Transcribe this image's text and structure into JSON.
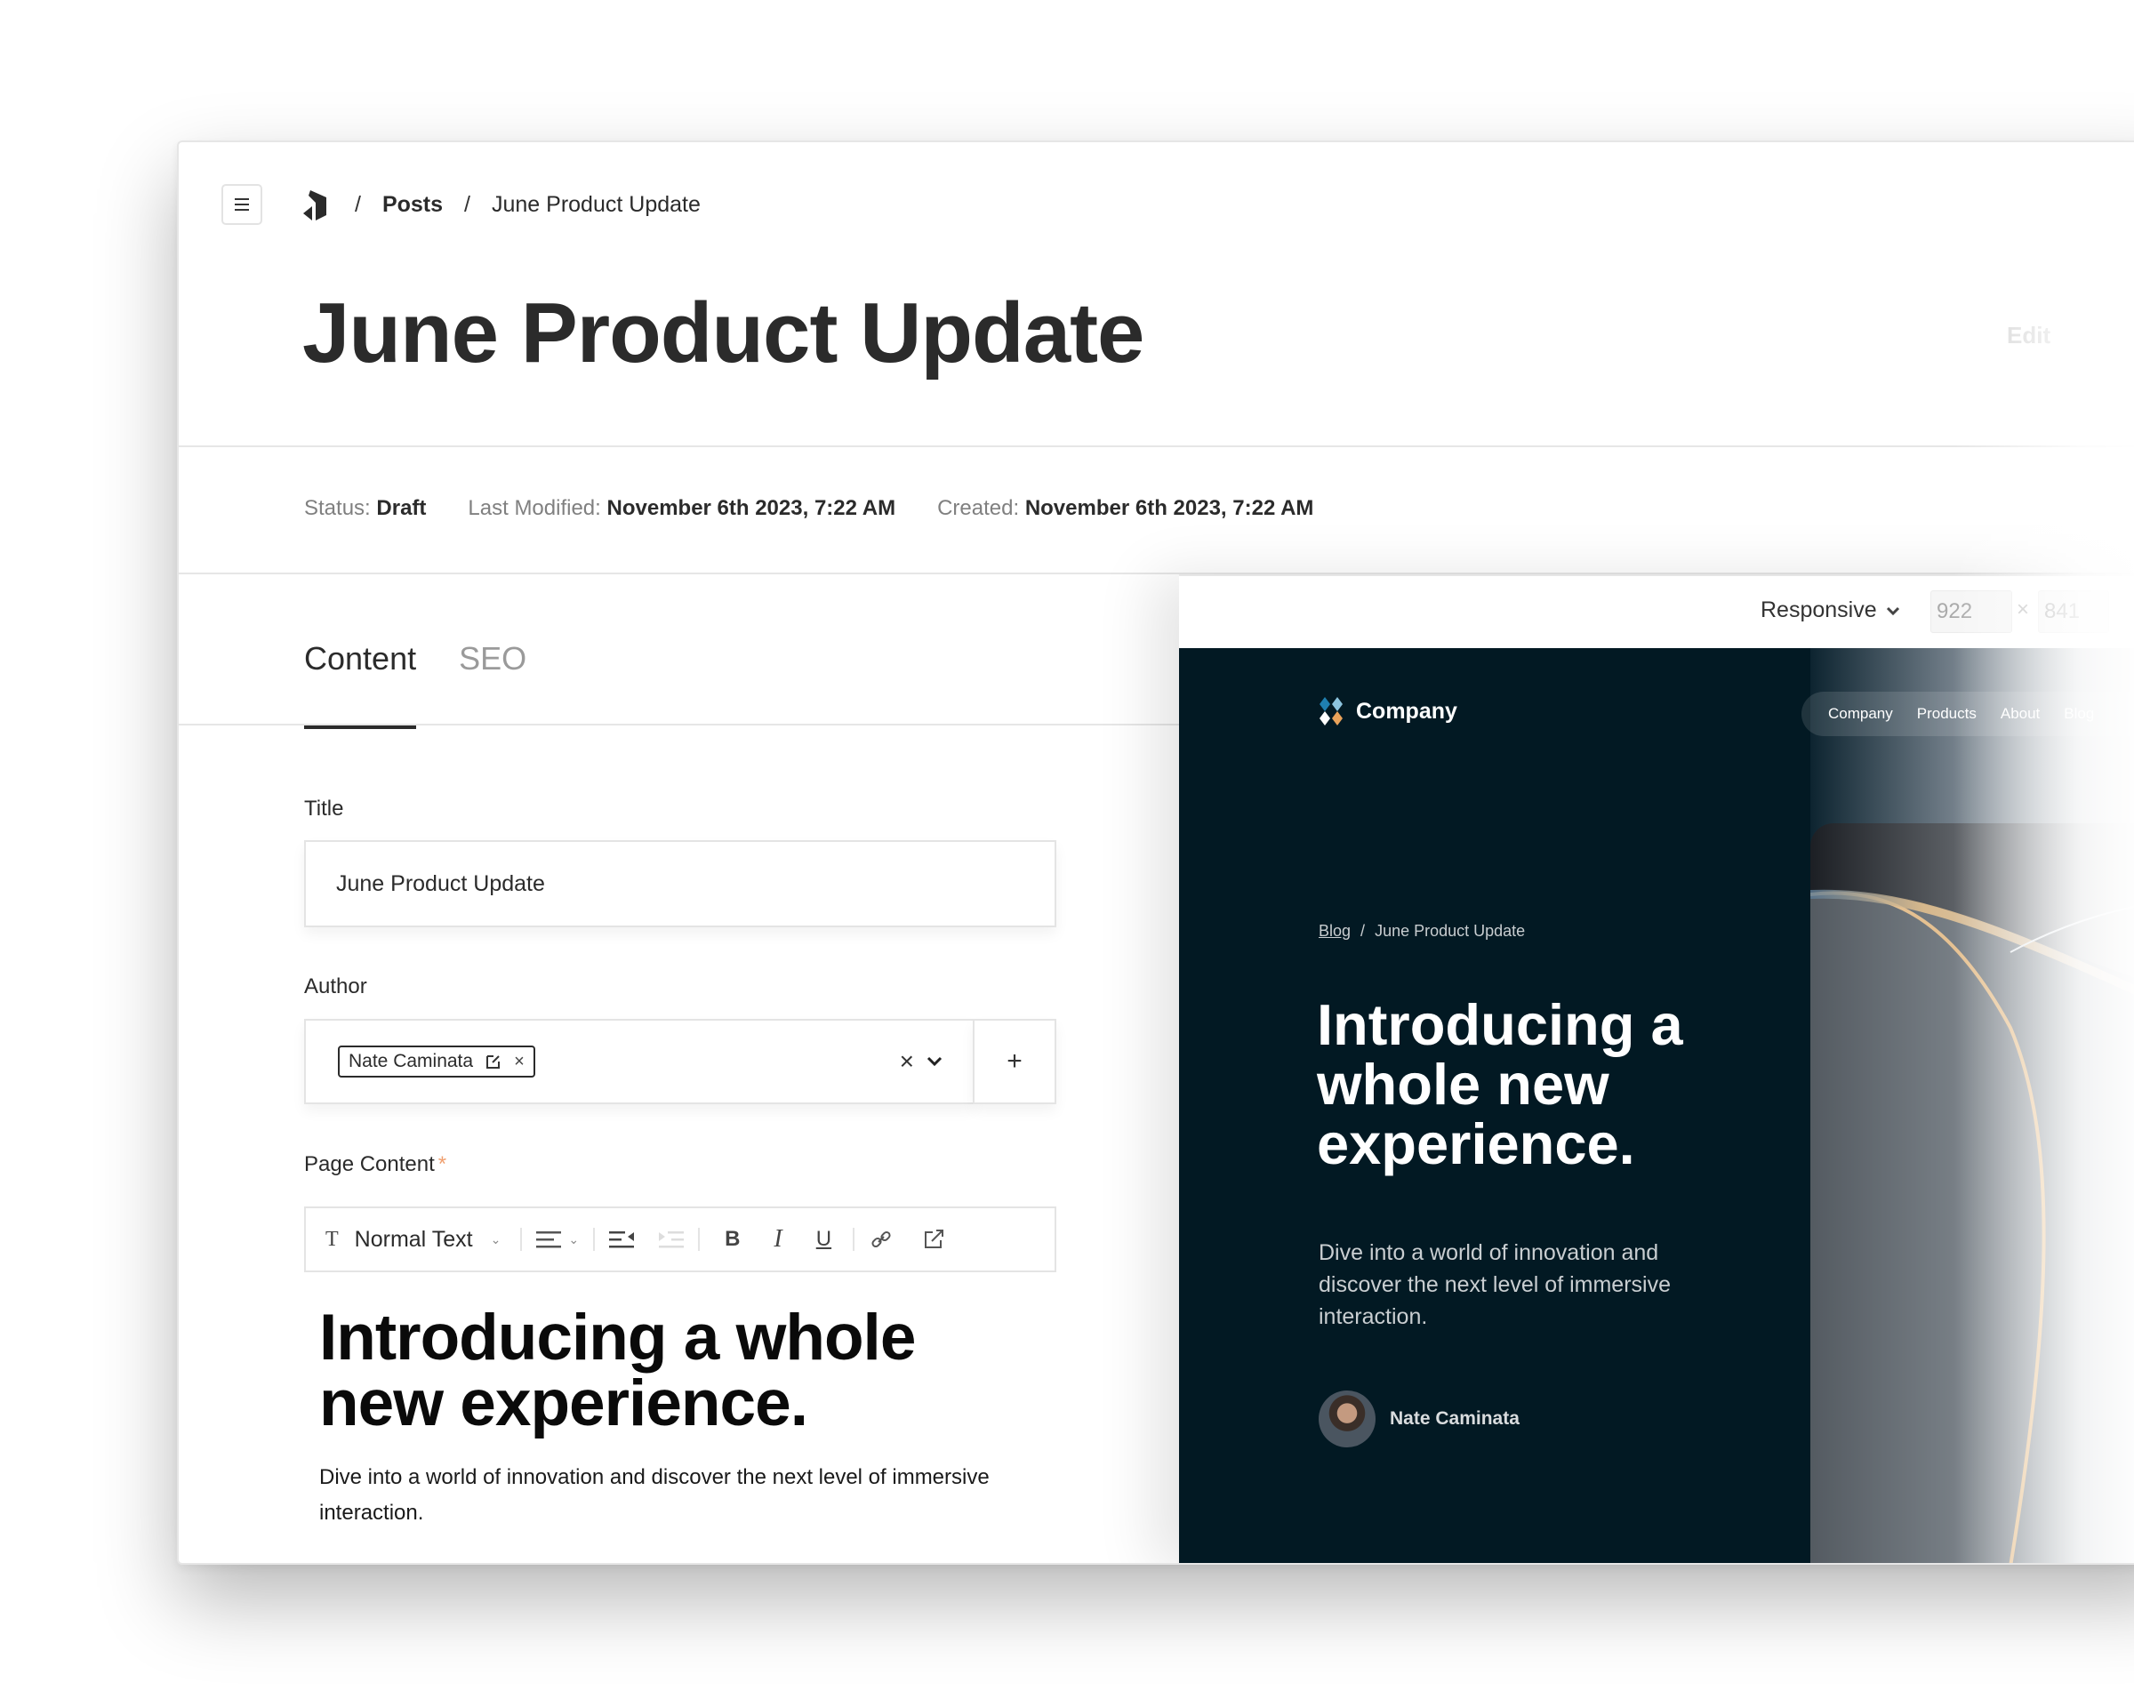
{
  "header": {
    "menu_icon": "hamburger-icon",
    "logo_icon": "brand-logo-icon",
    "breadcrumb": {
      "separator": "/",
      "posts": "Posts",
      "current": "June Product Update"
    },
    "page_title": "June Product Update",
    "edit_label": "Edit"
  },
  "meta": {
    "status_label": "Status:",
    "status_value": "Draft",
    "modified_label": "Last Modified:",
    "modified_value": "November 6th 2023, 7:22 AM",
    "created_label": "Created:",
    "created_value": "November 6th 2023, 7:22 AM"
  },
  "tabs": [
    {
      "label": "Content",
      "active": true
    },
    {
      "label": "SEO",
      "active": false
    }
  ],
  "form": {
    "title_label": "Title",
    "title_value": "June Product Update",
    "author_label": "Author",
    "author_chip": "Nate Caminata",
    "author_clear": "×",
    "author_add": "+",
    "page_content_label": "Page Content",
    "required_mark": "*"
  },
  "toolbar": {
    "text_style_icon": "T",
    "text_style": "Normal Text",
    "caret": "⌄",
    "bold": "B",
    "italic": "I",
    "underline": "U"
  },
  "editor": {
    "heading": "Introducing a whole new experience.",
    "paragraph": "Dive into a world of innovation and discover the next level of immersive interaction."
  },
  "preview": {
    "mode": "Responsive",
    "width": "922",
    "times": "×",
    "height": "841",
    "site": {
      "brand": "Company",
      "nav": [
        "Company",
        "Products",
        "About",
        "Blog"
      ],
      "crumb_link": "Blog",
      "crumb_sep": "/",
      "crumb_current": "June Product Update",
      "heading": "Introducing a whole new experience.",
      "paragraph": "Dive into a world of innovation and discover the next level of immersive interaction.",
      "author": "Nate Caminata"
    }
  },
  "colors": {
    "text_primary": "#2b2b2b",
    "text_muted": "#808080",
    "border": "#e4e4e4",
    "site_bg": "#021923",
    "required": "#f0a070",
    "logo_blue": "#1f7fb0",
    "logo_light_blue": "#8cc4de",
    "logo_orange": "#e9a25a"
  }
}
